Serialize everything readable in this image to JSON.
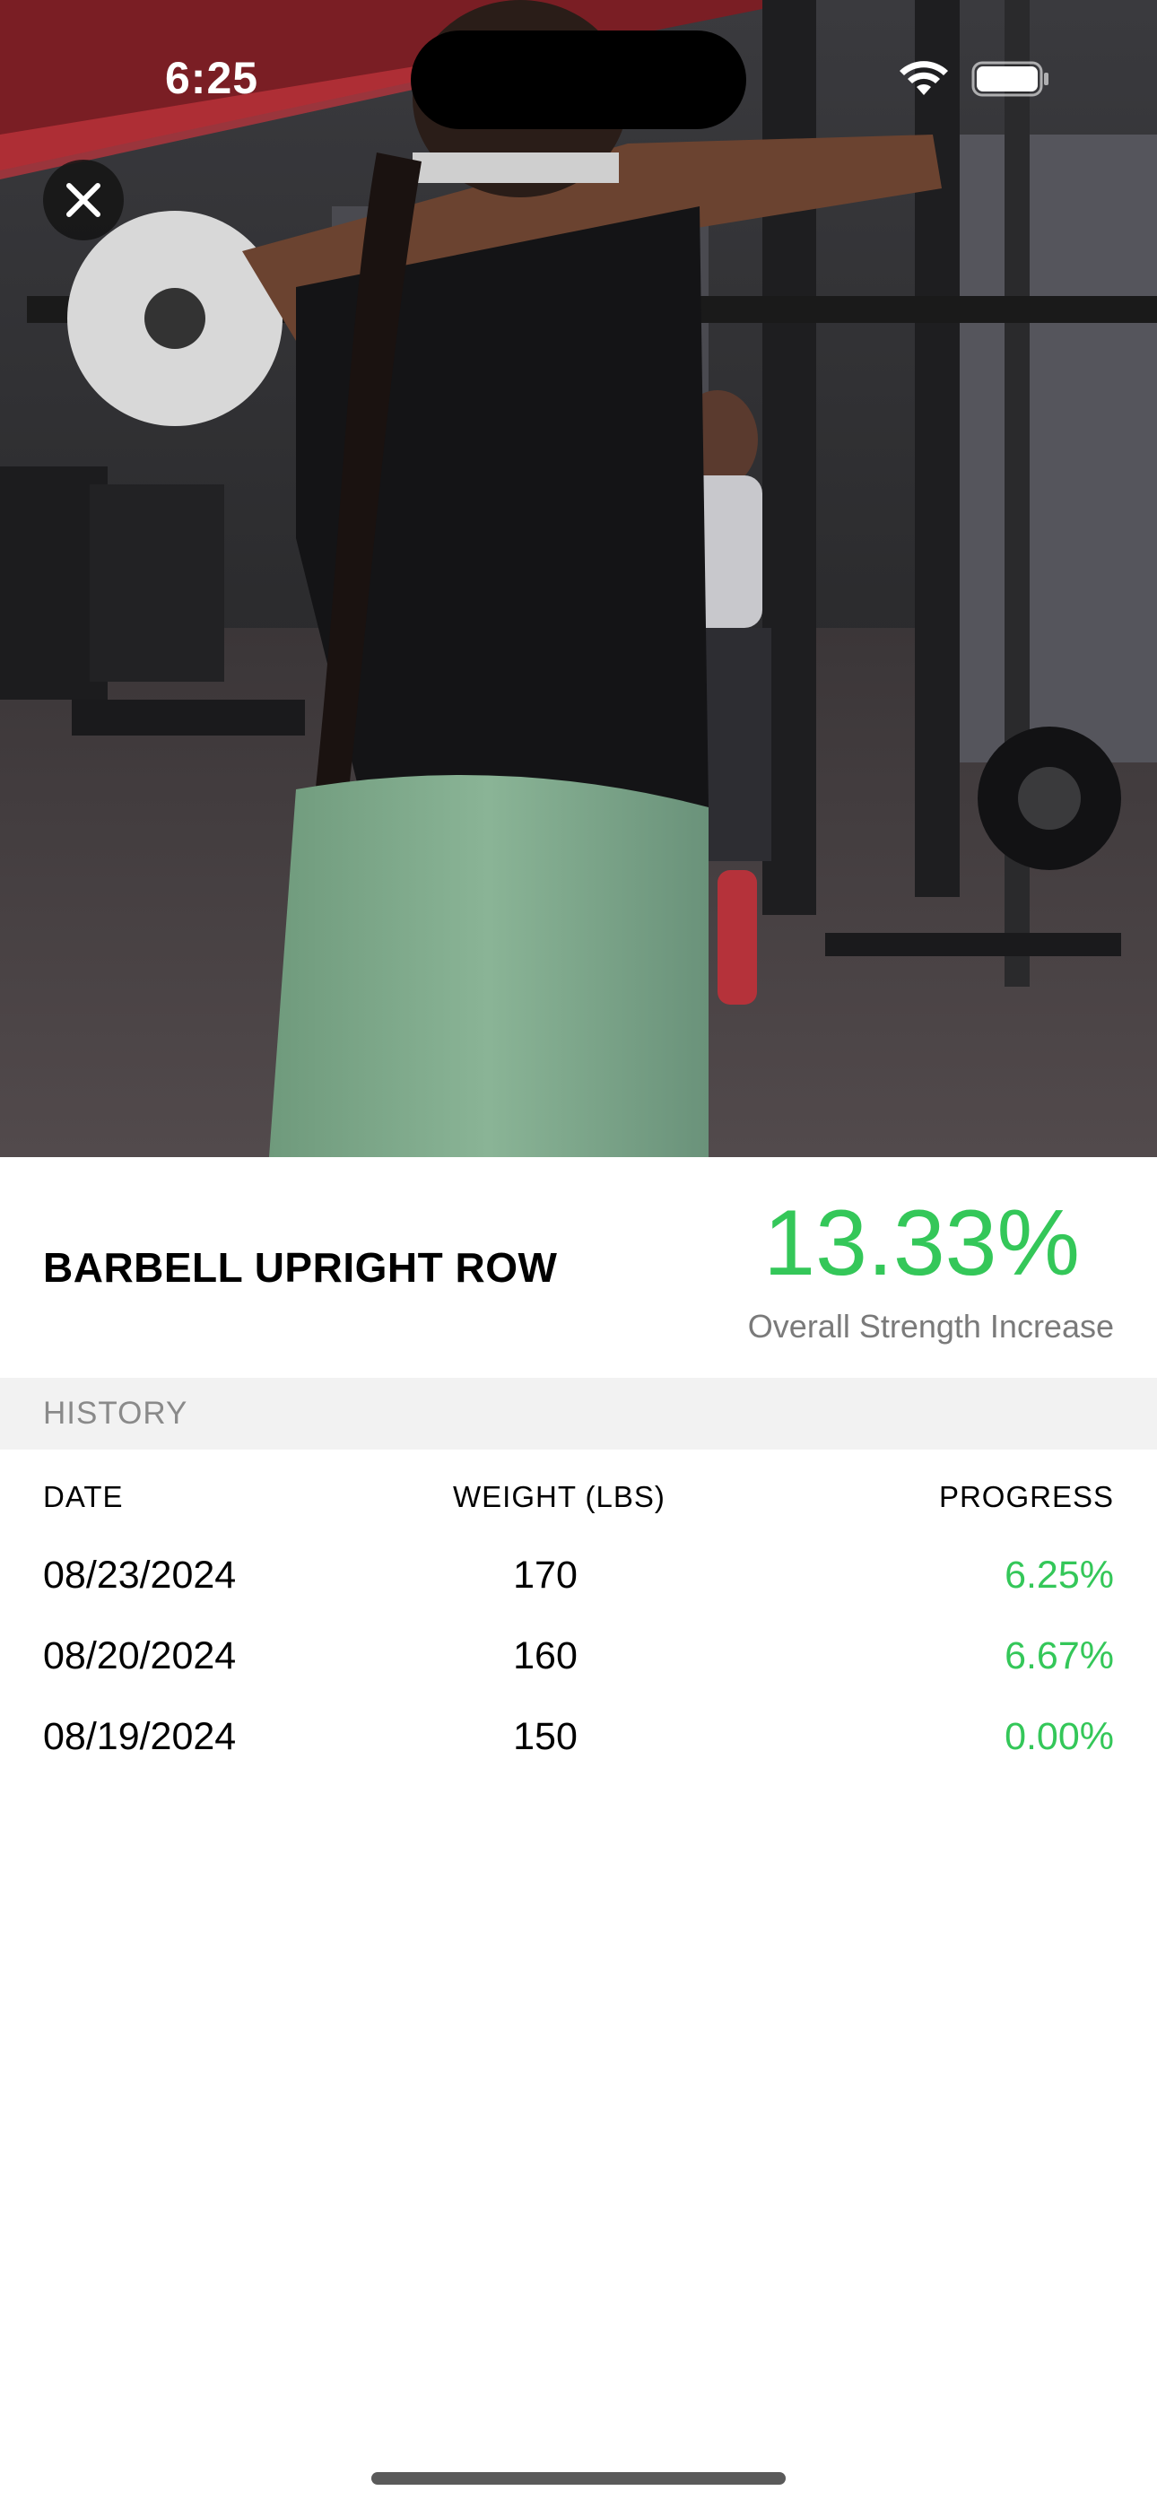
{
  "status_bar": {
    "time": "6:25"
  },
  "hero": {
    "description_icon": "workout-video-thumbnail"
  },
  "close_button": {
    "icon": "close-icon"
  },
  "exercise": {
    "name": "BARBELL UPRIGHT ROW",
    "overall_increase": "13.33%",
    "overall_caption": "Overall Strength Increase"
  },
  "history": {
    "label": "HISTORY",
    "columns": {
      "date": "DATE",
      "weight": "WEIGHT (LBS)",
      "progress": "PROGRESS"
    },
    "rows": [
      {
        "date": "08/23/2024",
        "weight": "170",
        "progress": "6.25%"
      },
      {
        "date": "08/20/2024",
        "weight": "160",
        "progress": "6.67%"
      },
      {
        "date": "08/19/2024",
        "weight": "150",
        "progress": "0.00%"
      }
    ]
  },
  "colors": {
    "accent_green": "#34c759",
    "muted_gray": "#7a7a7a",
    "section_bg": "#f2f2f2"
  }
}
